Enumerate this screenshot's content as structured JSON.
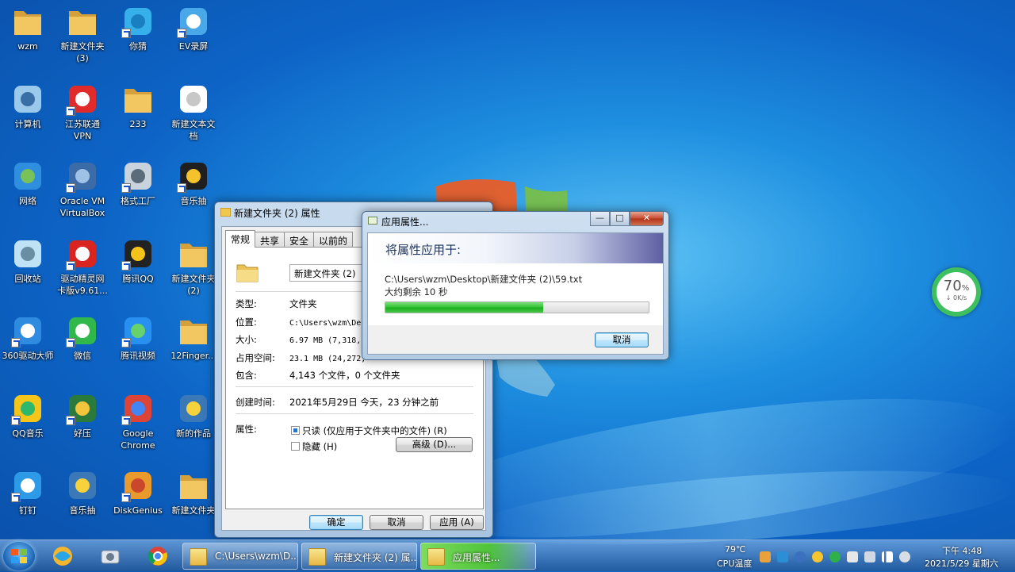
{
  "desktop": {
    "icons": [
      {
        "label": "wzm"
      },
      {
        "label": "新建文件夹\n(3)"
      },
      {
        "label": "你猜"
      },
      {
        "label": "EV录屏"
      },
      {
        "label": "计算机"
      },
      {
        "label": "江苏联通\nVPN"
      },
      {
        "label": "233"
      },
      {
        "label": "新建文本文\n档"
      },
      {
        "label": "网络"
      },
      {
        "label": "Oracle VM\nVirtualBox"
      },
      {
        "label": "格式工厂"
      },
      {
        "label": "音乐抽"
      },
      {
        "label": "回收站"
      },
      {
        "label": "驱动精灵网\n卡版v9.61..."
      },
      {
        "label": "腾讯QQ"
      },
      {
        "label": "新建文件夹\n(2)"
      },
      {
        "label": "360驱动大师"
      },
      {
        "label": "微信"
      },
      {
        "label": "腾讯视频"
      },
      {
        "label": "12Finger..."
      },
      {
        "label": "QQ音乐"
      },
      {
        "label": "好压"
      },
      {
        "label": "Google\nChrome"
      },
      {
        "label": "新的作品"
      },
      {
        "label": "钉钉"
      },
      {
        "label": "音乐抽"
      },
      {
        "label": "DiskGenius"
      },
      {
        "label": "新建文件夹"
      }
    ]
  },
  "properties": {
    "title": "新建文件夹 (2) 属性",
    "tabs": [
      "常规",
      "共享",
      "安全",
      "以前的"
    ],
    "name": "新建文件夹 (2)",
    "type_label": "类型:",
    "type_value": "文件夹",
    "location_label": "位置:",
    "location_value": "C:\\Users\\wzm\\Desk",
    "size_label": "大小:",
    "size_value": "6.97 MB (7,318,1",
    "disk_label": "占用空间:",
    "disk_value": "23.1 MB (24,272,",
    "contains_label": "包含:",
    "contains_value": "4,143 个文件，0 个文件夹",
    "created_label": "创建时间:",
    "created_value": "2021年5月29日 今天，23 分钟之前",
    "attr_label": "属性:",
    "readonly_label": "只读 (仅应用于文件夹中的文件) (R)",
    "hidden_label": "隐藏 (H)",
    "advanced_button": "高级 (D)...",
    "ok_button": "确定",
    "cancel_button": "取消",
    "apply_button": "应用 (A)"
  },
  "apply_dialog": {
    "title": "应用属性...",
    "heading": "将属性应用于:",
    "path": "C:\\Users\\wzm\\Desktop\\新建文件夹 (2)\\59.txt",
    "remaining": "大约剩余 10 秒",
    "progress": 0.6,
    "cancel_button": "取消",
    "close_glyph": "✕",
    "minimize_glyph": "—",
    "maximize_glyph": "□"
  },
  "network_widget": {
    "percent": "70",
    "percent_unit": "%",
    "speed": "↓ 0K/s"
  },
  "taskbar": {
    "tasks": [
      {
        "label": "C:\\Users\\wzm\\D..."
      },
      {
        "label": "新建文件夹 (2) 属..."
      },
      {
        "label": "应用属性..."
      }
    ],
    "temperature": "79℃",
    "temperature_label": "CPU温度",
    "time": "下午 4:48",
    "date": "2021/5/29 星期六"
  },
  "colors": {
    "progress_green": "#38c638",
    "desktop_blue": "#0d64c6"
  }
}
